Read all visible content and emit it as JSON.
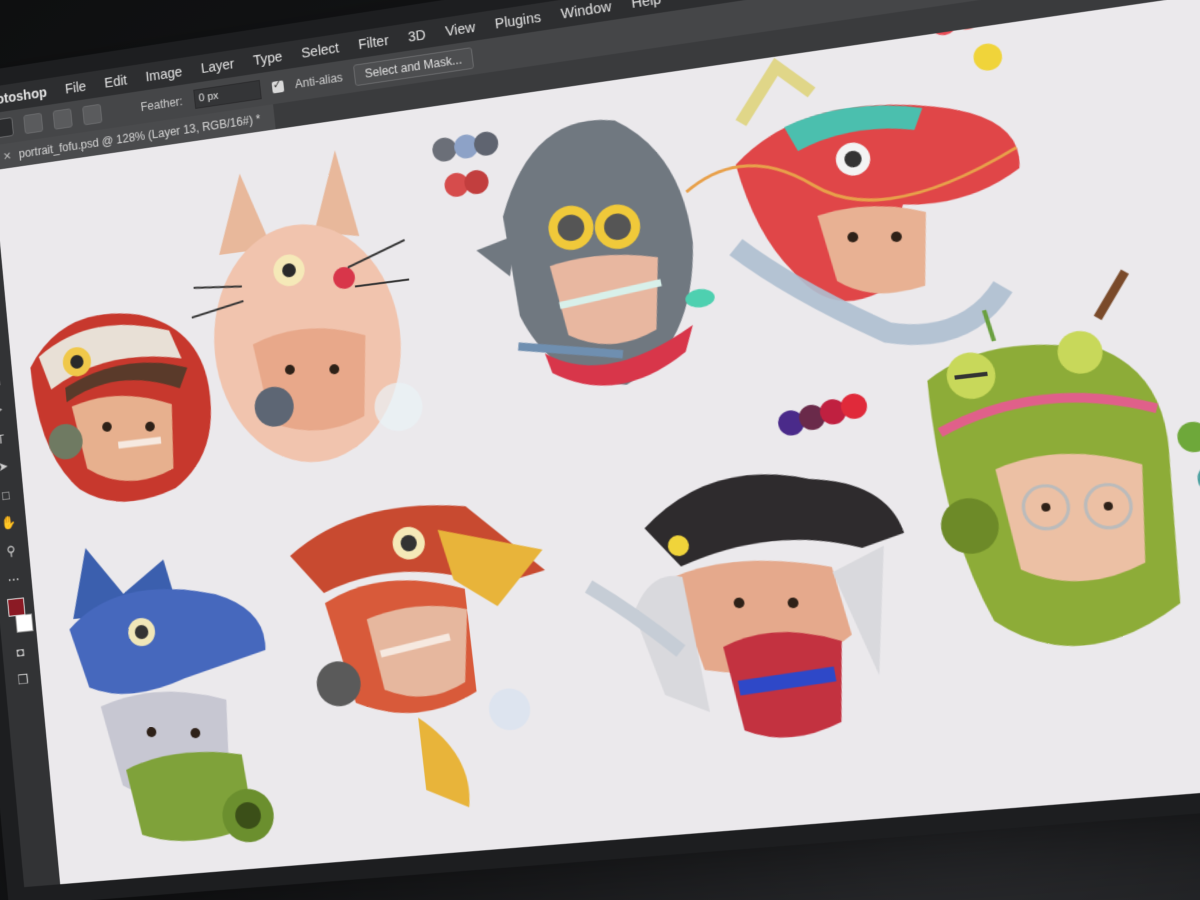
{
  "menu": {
    "app": "hotoshop",
    "items": [
      "File",
      "Edit",
      "Image",
      "Layer",
      "Type",
      "Select",
      "Filter",
      "3D",
      "View",
      "Plugins",
      "Window",
      "Help"
    ]
  },
  "options": {
    "feather_label": "Feather:",
    "feather_value": "0 px",
    "antialias_label": "Anti-alias",
    "select_mask_label": "Select and Mask..."
  },
  "document": {
    "tab_title": "portrait_fofu.psd @ 128% (Layer 13, RGB/16#) *"
  },
  "colors": {
    "foreground": "#8b1a24",
    "background": "#ffffff",
    "canvas": "#ebe9ec"
  },
  "tools": [
    "move-icon",
    "lasso-icon",
    "crop-icon",
    "eyedropper-icon",
    "brush-icon",
    "stamp-icon",
    "eraser-icon",
    "gradient-icon",
    "pen-icon",
    "type-icon",
    "path-select-icon",
    "shape-icon",
    "hand-icon",
    "zoom-icon"
  ],
  "artwork": [
    "tiger-helmet-portrait",
    "rabbit-helmet-portrait",
    "shark-helmet-portrait",
    "dragon-helmet-portrait",
    "wolf-gasmask-portrait",
    "eagle-helmet-portrait",
    "cap-oni-mask-portrait",
    "frog-helmet-portrait"
  ]
}
